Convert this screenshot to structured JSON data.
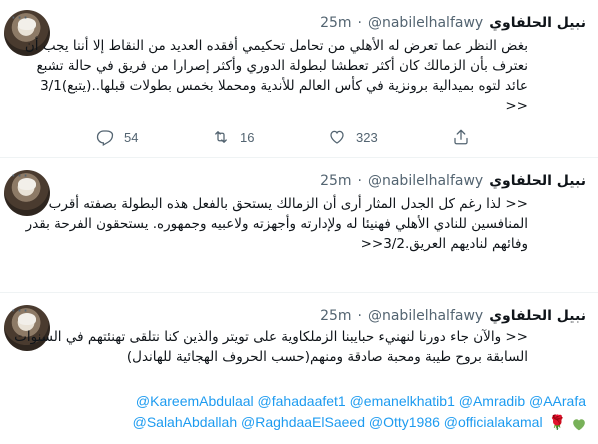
{
  "colors": {
    "accent": "#1d9bf0",
    "muted": "#536471",
    "text": "#0f1419",
    "heart_green": "#78b159",
    "rose": "#d0142a"
  },
  "tweets": [
    {
      "name": "نبيل الحلفاوي",
      "handle": "@nabilelhalfawy",
      "dot": "·",
      "time": "25m",
      "text": "بغض النظر عما تعرض له الأهلي من تحامل تحكيمي أفقده العديد من النقاط إلا أننا يجب أن نعترف بأن الزمالك كان أكثر تعطشا لبطولة الدوري وأكثر إصرارا من فريق في حالة تشبع عائد لتوه بميدالية برونزية في كأس العالم للأندية ومحملا بخمس بطولات قبلها..(يتبع)3/1 <<",
      "actions": {
        "replies": "54",
        "retweets": "16",
        "likes": "323"
      }
    },
    {
      "name": "نبيل الحلفاوي",
      "handle": "@nabilelhalfawy",
      "dot": "·",
      "time": "25m",
      "text": "<< لذا رغم كل الجدل المثار أرى أن الزمالك يستحق بالفعل هذه البطولة بصفته أقرب المنافسين للنادي الأهلي فهنيئا له ولإدارته وأجهزته ولاعبيه وجمهوره. يستحقون الفرحة بقدر وفائهم لناديهم العريق.3/2<<"
    },
    {
      "name": "نبيل الحلفاوي",
      "handle": "@nabilelhalfawy",
      "dot": "·",
      "time": "25m",
      "text": "<< والآن جاء دورنا لنهنيء حبايبنا الزملكاوية على تويتر والذين كنا نتلقى تهنئتهم في السنوات السابقة  بروح طيبة ومحبة صادقة ومنهم(حسب الحروف الهجائية للهاندل)",
      "mentions_line1": "@KareemAbdulaal @fahadaafet1 @emanelkhatib1 @Amradib @AArafa",
      "mentions_line2": "@SalahAbdallah @RaghdaaElSaeed @Otty1986 @officialakamal",
      "emojis": [
        "green-heart",
        "rose"
      ]
    }
  ]
}
